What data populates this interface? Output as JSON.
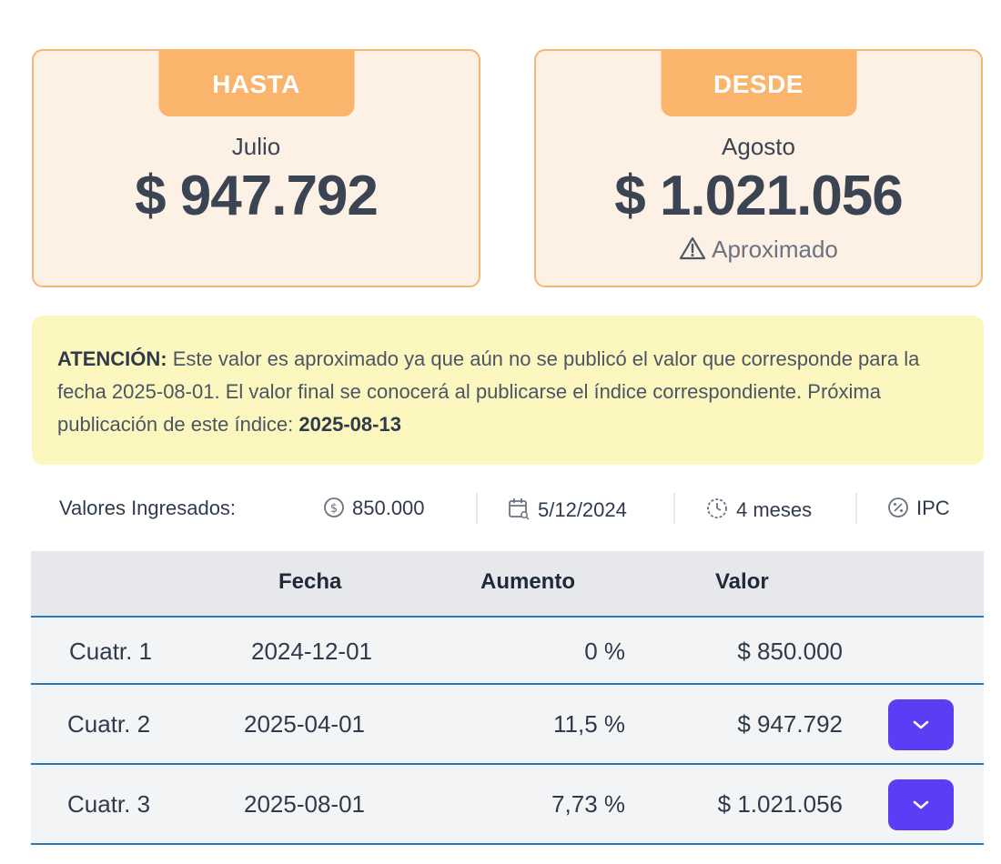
{
  "cards": {
    "hasta": {
      "tab_label": "HASTA",
      "month": "Julio",
      "amount": "$ 947.792"
    },
    "desde": {
      "tab_label": "DESDE",
      "month": "Agosto",
      "amount": "$ 1.021.056",
      "note": "Aproximado",
      "note_icon": "warning-triangle-icon"
    }
  },
  "notice": {
    "bold_prefix": "ATENCIÓN:",
    "text": " Este valor es aproximado ya que aún no se publicó el valor que corresponde para la fecha 2025-08-01. El valor final se conocerá al publicarse el índice correspondiente. Próxima publicación de este índice: ",
    "next_date": "2025-08-13",
    "background_color": "#fcf6bf"
  },
  "inputs": {
    "label": "Valores Ingresados:",
    "amount": "850.000",
    "amount_icon": "dollar-circle-icon",
    "date": "5/12/2024",
    "date_icon": "calendar-icon",
    "period": "4 meses",
    "period_icon": "clock-icon",
    "index": "IPC",
    "index_icon": "percent-circle-icon"
  },
  "table": {
    "headers": {
      "fecha": "Fecha",
      "aumento": "Aumento",
      "valor": "Valor"
    },
    "rows": [
      {
        "label": "Cuatr. 1",
        "fecha": "2024-12-01",
        "aumento": "0 %",
        "valor": "$ 850.000",
        "expandable": false
      },
      {
        "label": "Cuatr. 2",
        "fecha": "2025-04-01",
        "aumento": "11,5 %",
        "valor": "$ 947.792",
        "expandable": true
      },
      {
        "label": "Cuatr. 3",
        "fecha": "2025-08-01",
        "aumento": "7,73 %",
        "valor": "$ 1.021.056",
        "expandable": true
      }
    ]
  },
  "colors": {
    "card_bg": "#fdf1e6",
    "card_border": "#f6b671",
    "tab_bg": "#fbb46b",
    "row_border": "#2b7ab8",
    "expand_button": "#5b3df5"
  }
}
